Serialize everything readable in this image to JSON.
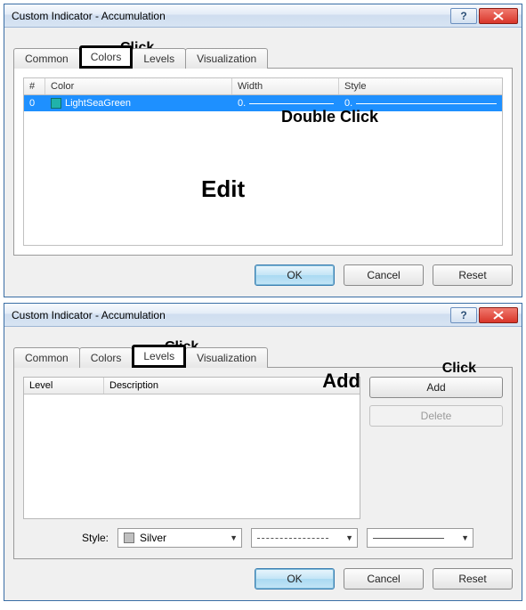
{
  "window1": {
    "title": "Custom Indicator - Accumulation",
    "tabs": {
      "common": "Common",
      "colors": "Colors",
      "levels": "Levels",
      "visualization": "Visualization"
    },
    "headers": {
      "num": "#",
      "color": "Color",
      "width": "Width",
      "style": "Style"
    },
    "row": {
      "index": "0",
      "color_name": "LightSeaGreen",
      "width_val": "0.",
      "style_val": "0."
    },
    "buttons": {
      "ok": "OK",
      "cancel": "Cancel",
      "reset": "Reset"
    },
    "annot": {
      "click": "Click",
      "dblclick": "Double Click",
      "edit": "Edit"
    }
  },
  "window2": {
    "title": "Custom Indicator - Accumulation",
    "tabs": {
      "common": "Common",
      "colors": "Colors",
      "levels": "Levels",
      "visualization": "Visualization"
    },
    "headers": {
      "level": "Level",
      "description": "Description"
    },
    "buttons": {
      "add": "Add",
      "delete": "Delete",
      "ok": "OK",
      "cancel": "Cancel",
      "reset": "Reset"
    },
    "style": {
      "label": "Style:",
      "color": "Silver"
    },
    "annot": {
      "click_tab": "Click",
      "add_lbl": "Add",
      "click_btn": "Click"
    }
  }
}
